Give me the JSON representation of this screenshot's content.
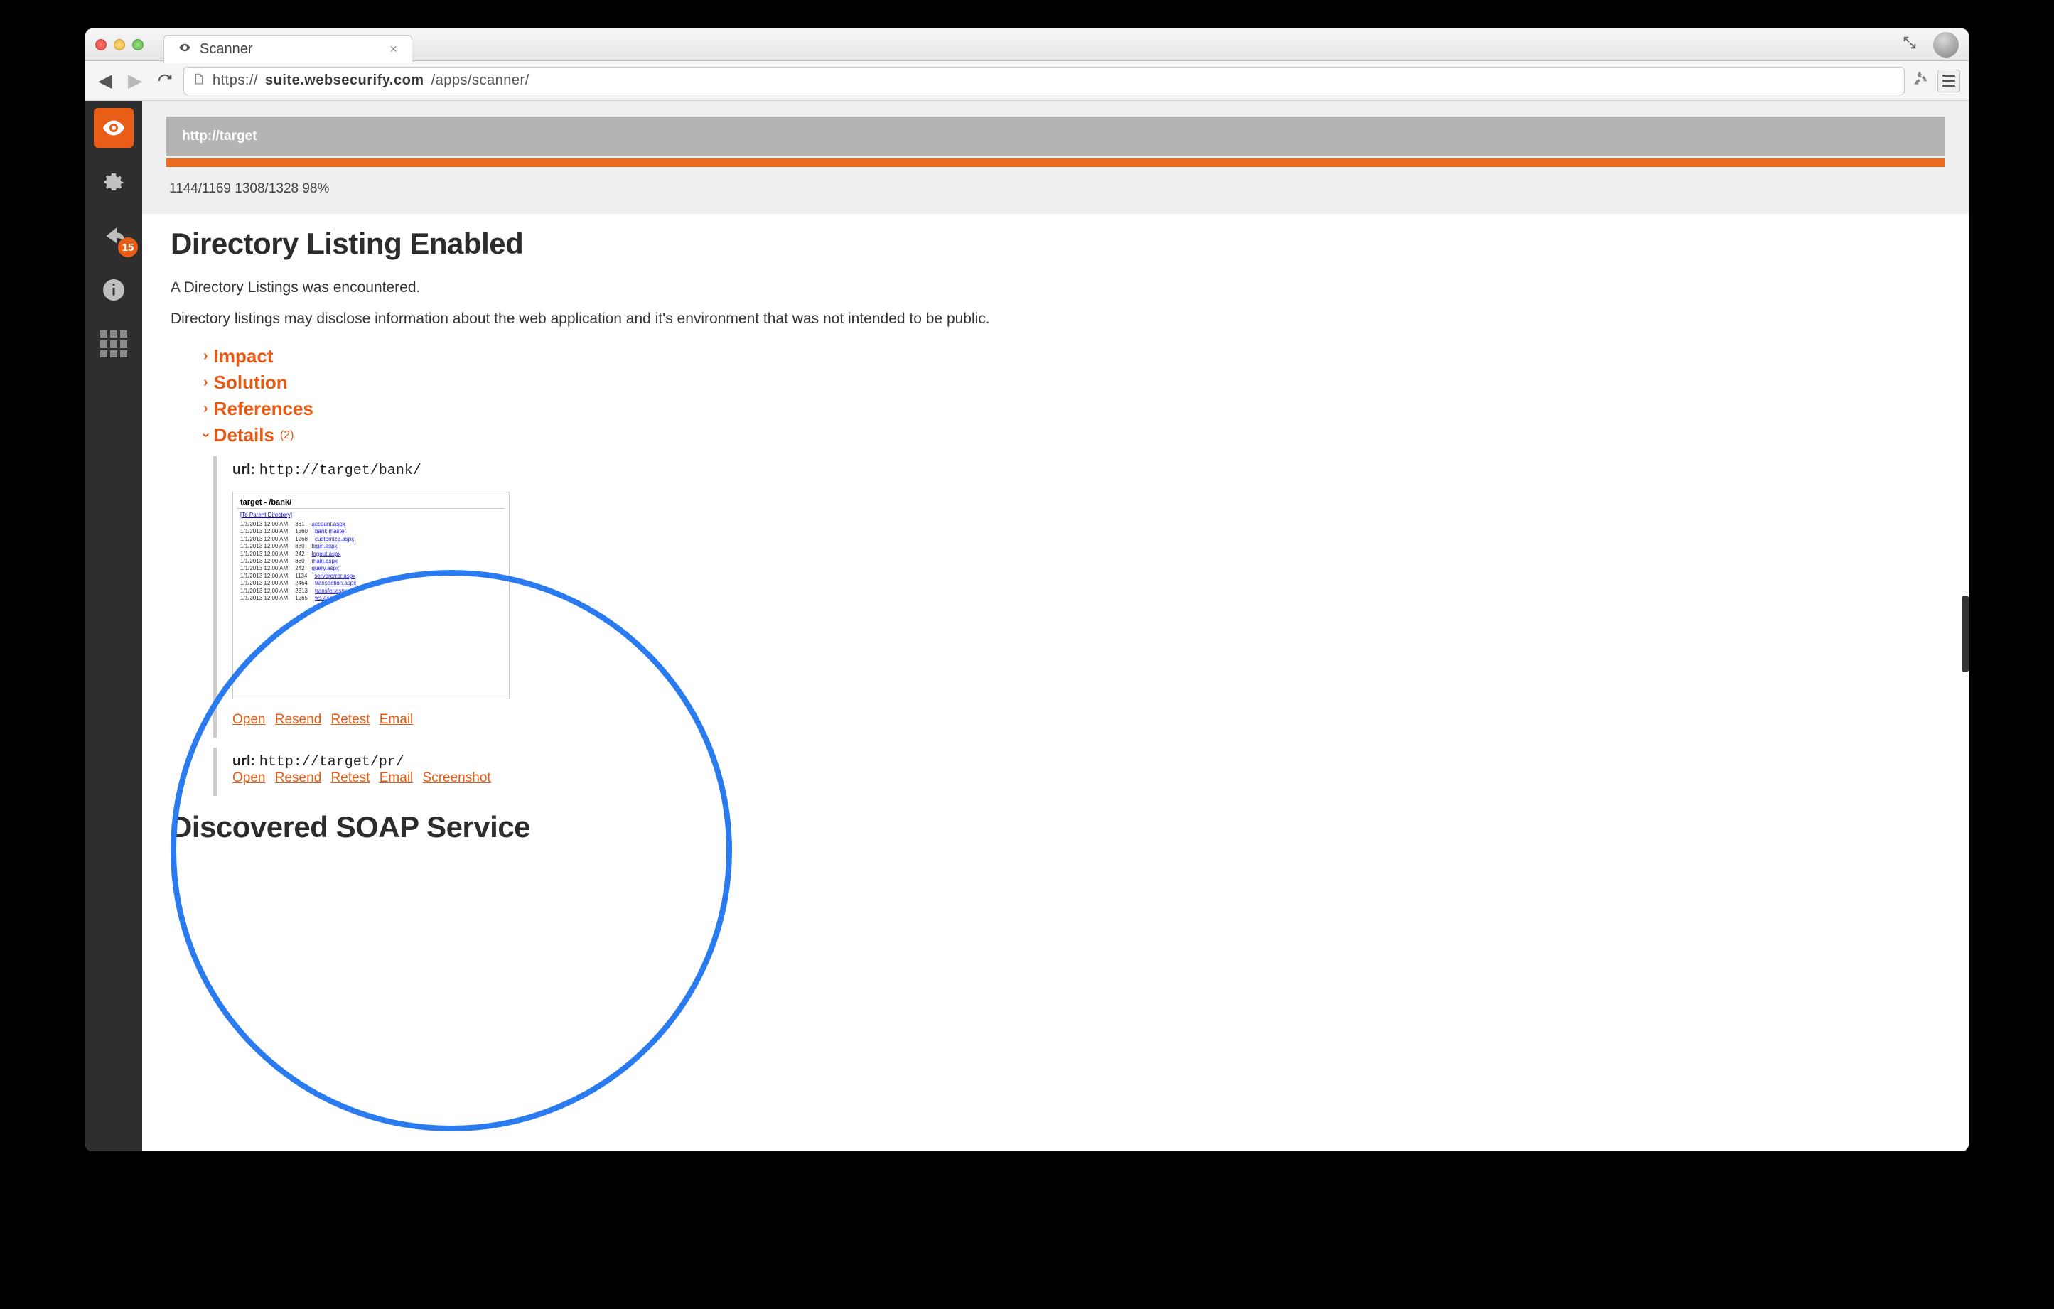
{
  "browser": {
    "tab_title": "Scanner",
    "url_prefix": "https://",
    "url_bold": "suite.websecurify.com",
    "url_suffix": "/apps/scanner/"
  },
  "sidebar": {
    "badge": "15"
  },
  "target": {
    "input": "http://target",
    "stats": "1144/1169 1308/1328 98%"
  },
  "finding1": {
    "title": "Directory Listing Enabled",
    "desc1": "A Directory Listings was encountered.",
    "desc2": "Directory listings may disclose information about the web application and it's environment that was not intended to be public.",
    "items": {
      "impact": "Impact",
      "solution": "Solution",
      "references": "References",
      "details": "Details",
      "details_count": "(2)"
    },
    "det1": {
      "label": "url:",
      "value": "http://target/bank/",
      "thumb_title": "target - /bank/",
      "thumb_sub": "[To Parent Directory]",
      "actions": {
        "open": "Open",
        "resend": "Resend",
        "retest": "Retest",
        "email": "Email"
      }
    },
    "det2": {
      "label": "url:",
      "value": "http://target/pr/",
      "actions": {
        "open": "Open",
        "resend": "Resend",
        "retest": "Retest",
        "email": "Email",
        "screenshot": "Screenshot"
      }
    }
  },
  "finding2": {
    "title": "Discovered SOAP Service"
  }
}
